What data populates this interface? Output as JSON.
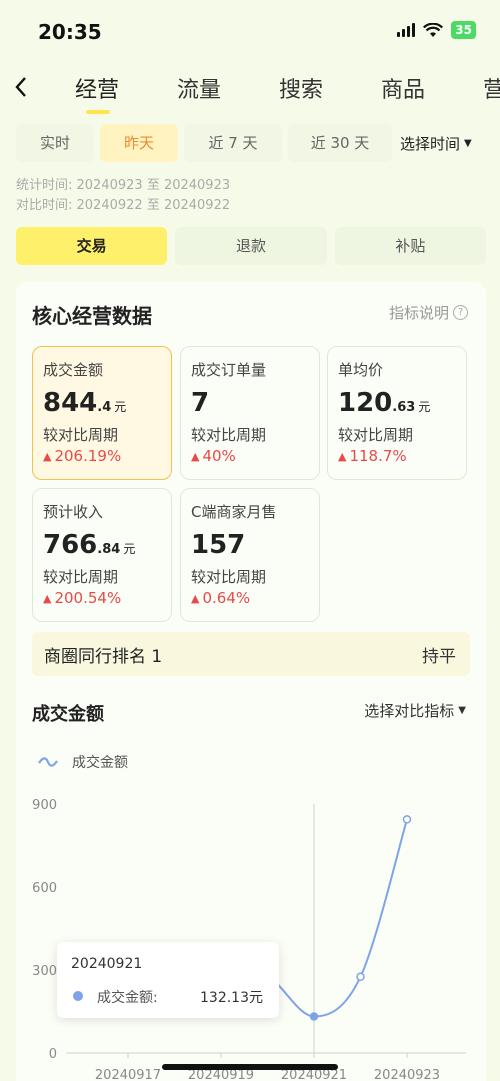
{
  "status_bar": {
    "time": "20:35",
    "battery": "35"
  },
  "nav": {
    "back_icon": "back-arrow-icon",
    "tabs": [
      {
        "label": "经营"
      },
      {
        "label": "流量"
      },
      {
        "label": "搜索"
      },
      {
        "label": "商品"
      },
      {
        "label": "营"
      }
    ]
  },
  "ranges": {
    "items": [
      {
        "label": "实时"
      },
      {
        "label": "昨天"
      },
      {
        "label": "近 7 天"
      },
      {
        "label": "近 30 天"
      }
    ],
    "select_label": "选择时间"
  },
  "stat_period": {
    "line1": "统计时间:  20240923 至 20240923",
    "line2": "对比时间:  20240922 至 20240922"
  },
  "subtabs": [
    {
      "label": "交易"
    },
    {
      "label": "退款"
    },
    {
      "label": "补贴"
    }
  ],
  "core": {
    "title": "核心经营数据",
    "help_label": "指标说明",
    "help_icon": "question-circle-icon",
    "metrics": [
      {
        "label": "成交金额",
        "int": "844",
        "dec": ".4",
        "unit": "元",
        "cmp": "较对比周期",
        "change": "206.19%"
      },
      {
        "label": "成交订单量",
        "int": "7",
        "dec": "",
        "unit": "",
        "cmp": "较对比周期",
        "change": "40%"
      },
      {
        "label": "单均价",
        "int": "120",
        "dec": ".63",
        "unit": "元",
        "cmp": "较对比周期",
        "change": "118.7%"
      },
      {
        "label": "预计收入",
        "int": "766",
        "dec": ".84",
        "unit": "元",
        "cmp": "较对比周期",
        "change": "200.54%"
      },
      {
        "label": "C端商家月售",
        "int": "157",
        "dec": "",
        "unit": "",
        "cmp": "较对比周期",
        "change": "0.64%"
      }
    ],
    "rank_label": "商圈同行排名 1",
    "rank_status": "持平"
  },
  "trend": {
    "title": "成交金额",
    "select_label": "选择对比指标",
    "legend_label": "成交金额",
    "legend_icon": "wave-line-icon",
    "tooltip": {
      "date": "20240921",
      "label": "成交金额:",
      "value": "132.13元"
    }
  },
  "colors": {
    "line": "#7fa3e8",
    "accent": "#fff06b",
    "up": "#e84a4a",
    "active_range": "#f08a2c"
  },
  "chart_data": {
    "type": "line",
    "x": [
      "20240917",
      "20240918",
      "20240919",
      "20240920",
      "20240921",
      "20240922",
      "20240923"
    ],
    "x_tick_labels": [
      "20240917",
      "20240919",
      "20240921",
      "20240923"
    ],
    "series": [
      {
        "name": "成交金额",
        "values": [
          null,
          null,
          330,
          280,
          132.13,
          275.6,
          844.4
        ]
      }
    ],
    "y_ticks": [
      0,
      300,
      600,
      900
    ],
    "ylim": [
      0,
      900
    ],
    "grid": false,
    "highlight": "20240921"
  }
}
